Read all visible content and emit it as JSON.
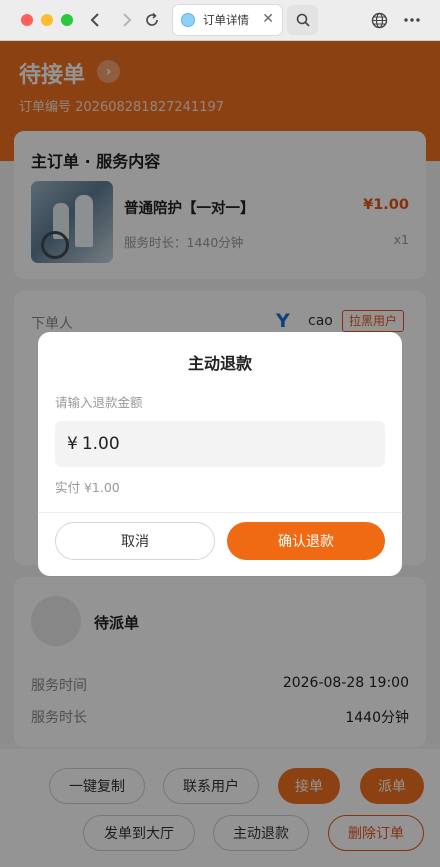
{
  "browser": {
    "tab_title": "订单详情"
  },
  "header": {
    "status": "待接单",
    "order_number": "订单编号 202608281827241197"
  },
  "service_card": {
    "title": "主订单 · 服务内容",
    "item_name": "普通陪护【一对一】",
    "price": "¥1.00",
    "duration": "服务时长：1440分钟",
    "quantity": "x1"
  },
  "order_info": {
    "orderer_label": "下单人",
    "orderer_name": "cao",
    "blacklist_tag": "拉黑用户"
  },
  "worker_card": {
    "status": "待派单",
    "service_time_label": "服务时间",
    "service_time_value": "2026-08-28 19:00",
    "service_duration_label": "服务时长",
    "service_duration_value": "1440分钟"
  },
  "actions": {
    "copy": "一键复制",
    "contact": "联系用户",
    "accept": "接单",
    "dispatch": "派单",
    "to_hall": "发单到大厅",
    "refund": "主动退款",
    "delete": "删除订单"
  },
  "refund_modal": {
    "title": "主动退款",
    "prompt": "请输入退款金额",
    "currency": "¥",
    "amount": "1.00",
    "actual_paid": "实付 ¥1.00",
    "cancel": "取消",
    "confirm": "确认退款"
  },
  "colors": {
    "brand": "#f17022",
    "danger": "#e8541d"
  }
}
